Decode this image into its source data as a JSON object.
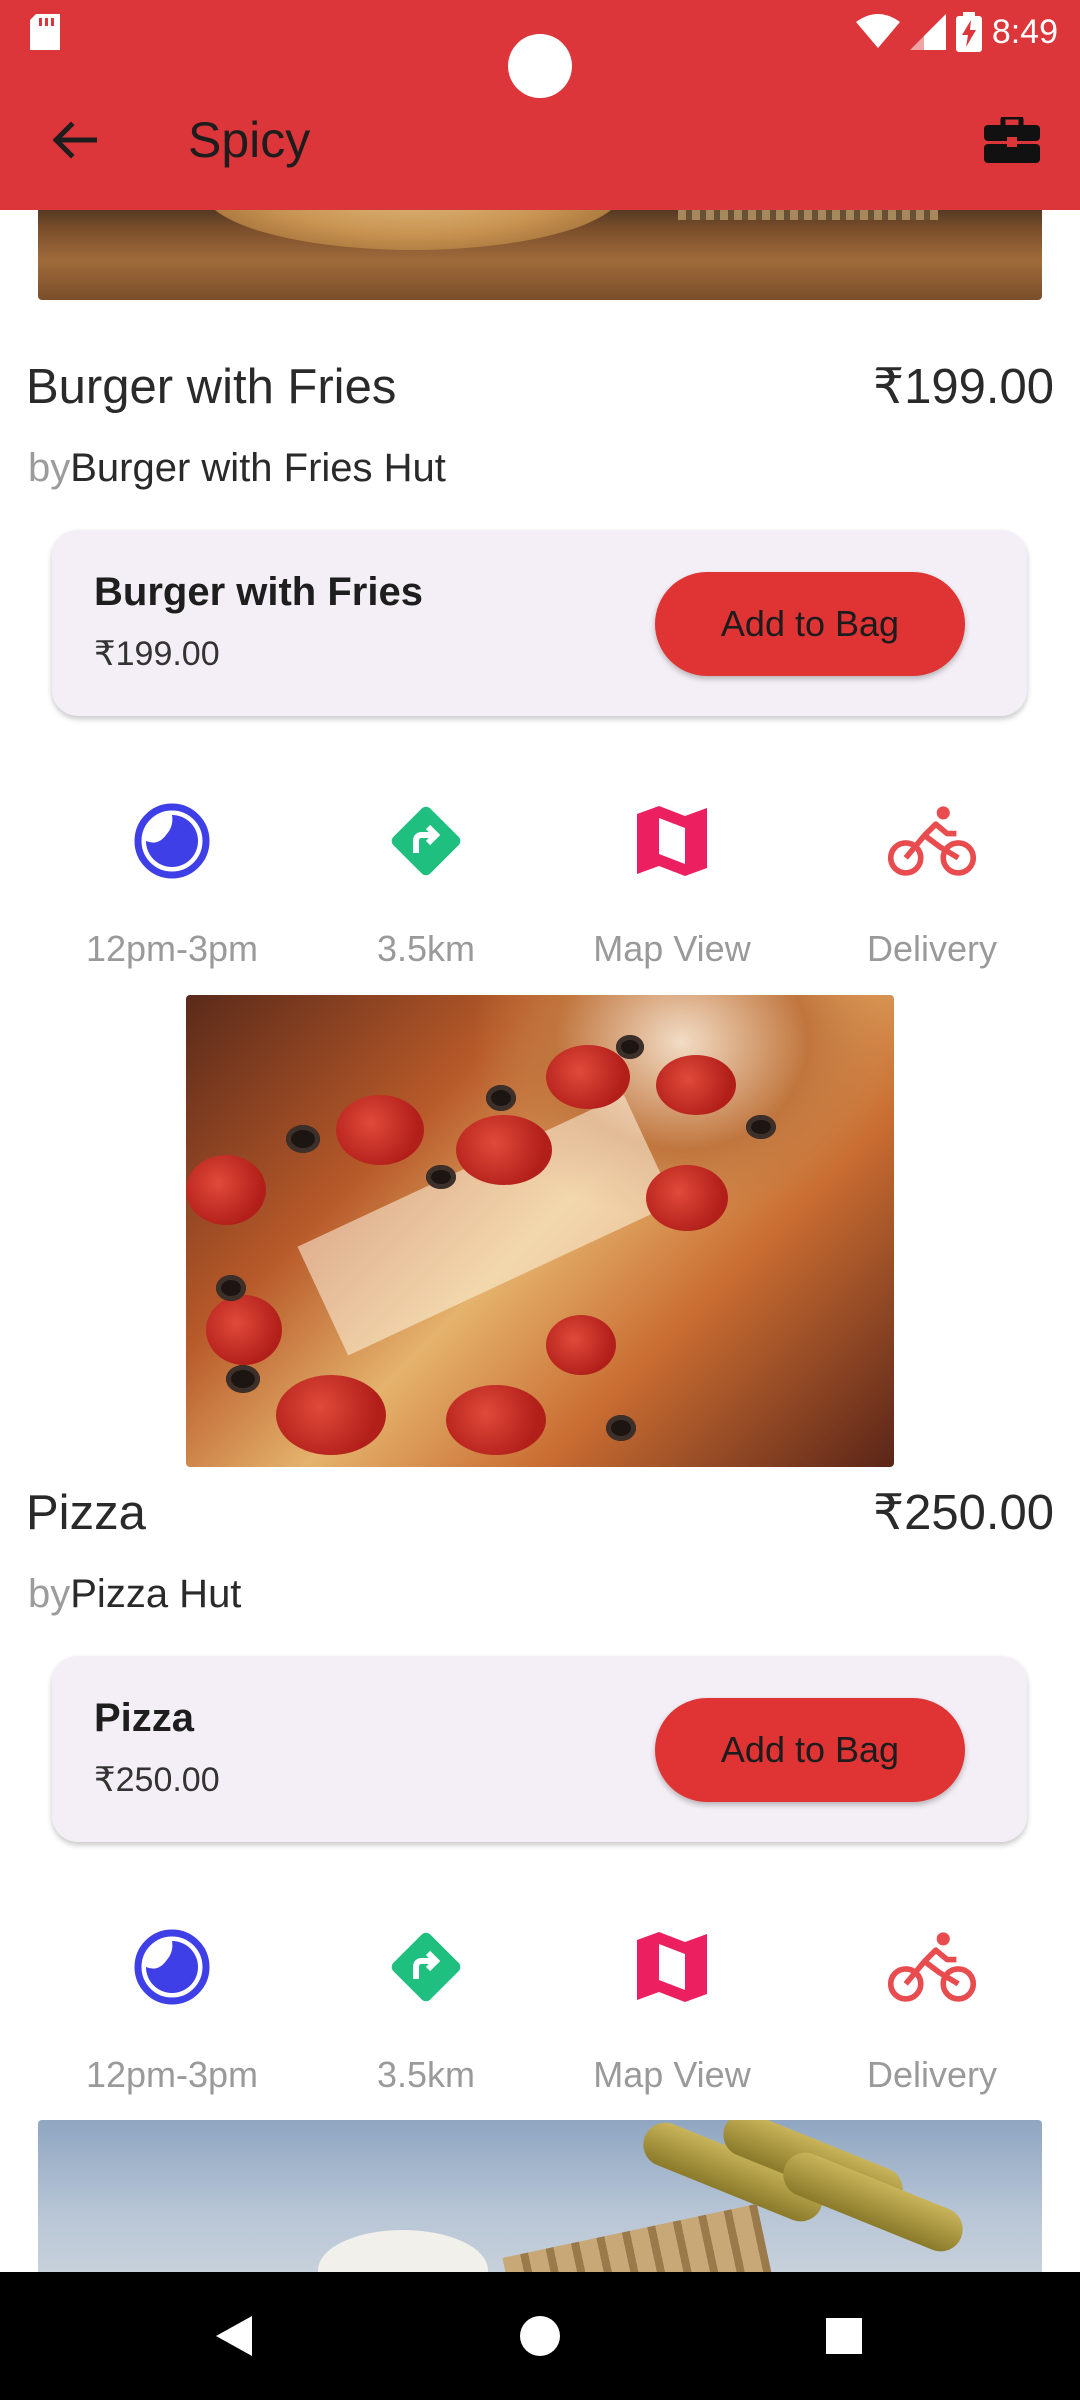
{
  "status_bar": {
    "time": "8:49"
  },
  "toolbar": {
    "title": "Spicy",
    "back_icon": "arrow-left-icon",
    "bag_icon": "briefcase-icon"
  },
  "colors": {
    "accent": "#dc353a",
    "button": "#e03334",
    "card_bg": "#f4eff6",
    "clock": "#3f3fe8",
    "directions": "#1fbf80",
    "map": "#ec1f61",
    "delivery": "#e84c4f"
  },
  "items": [
    {
      "name": "Burger with Fries",
      "price": "₹199.00",
      "by_prefix": "by",
      "vendor": "Burger with Fries Hut",
      "card": {
        "title": "Burger with Fries",
        "price": "₹199.00",
        "button": "Add to Bag"
      },
      "info": [
        {
          "icon": "clock-icon",
          "label": "12pm-3pm"
        },
        {
          "icon": "directions-icon",
          "label": "3.5km"
        },
        {
          "icon": "map-icon",
          "label": "Map View"
        },
        {
          "icon": "bicycle-icon",
          "label": "Delivery"
        }
      ]
    },
    {
      "name": "Pizza",
      "price": "₹250.00",
      "by_prefix": "by",
      "vendor": "Pizza Hut",
      "card": {
        "title": "Pizza",
        "price": "₹250.00",
        "button": "Add to Bag"
      },
      "info": [
        {
          "icon": "clock-icon",
          "label": "12pm-3pm"
        },
        {
          "icon": "directions-icon",
          "label": "3.5km"
        },
        {
          "icon": "map-icon",
          "label": "Map View"
        },
        {
          "icon": "bicycle-icon",
          "label": "Delivery"
        }
      ]
    }
  ]
}
